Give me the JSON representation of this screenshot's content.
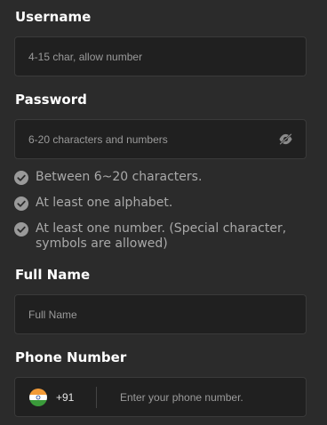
{
  "username": {
    "label": "Username",
    "placeholder": "4-15 char, allow number",
    "value": ""
  },
  "password": {
    "label": "Password",
    "placeholder": "6-20 characters and numbers",
    "value": "",
    "toggle_icon": "eye-off-icon"
  },
  "password_rules": [
    {
      "text": "Between 6~20 characters.",
      "icon": "check-circle-icon"
    },
    {
      "text": "At least one alphabet.",
      "icon": "check-circle-icon"
    },
    {
      "text_line1": "At least one number. (Special character,",
      "text_line2": "symbols are allowed)",
      "icon": "check-circle-icon"
    }
  ],
  "full_name": {
    "label": "Full Name",
    "placeholder": "Full Name",
    "value": ""
  },
  "phone": {
    "label": "Phone Number",
    "country_code": "+91",
    "flag_icon": "india-flag-icon",
    "placeholder": "Enter your phone number.",
    "value": ""
  },
  "colors": {
    "background": "#2b2b2b",
    "field_background": "#202020",
    "label": "#ffffff",
    "placeholder": "#9a9a9a",
    "rule_text": "#a9a9a9"
  }
}
